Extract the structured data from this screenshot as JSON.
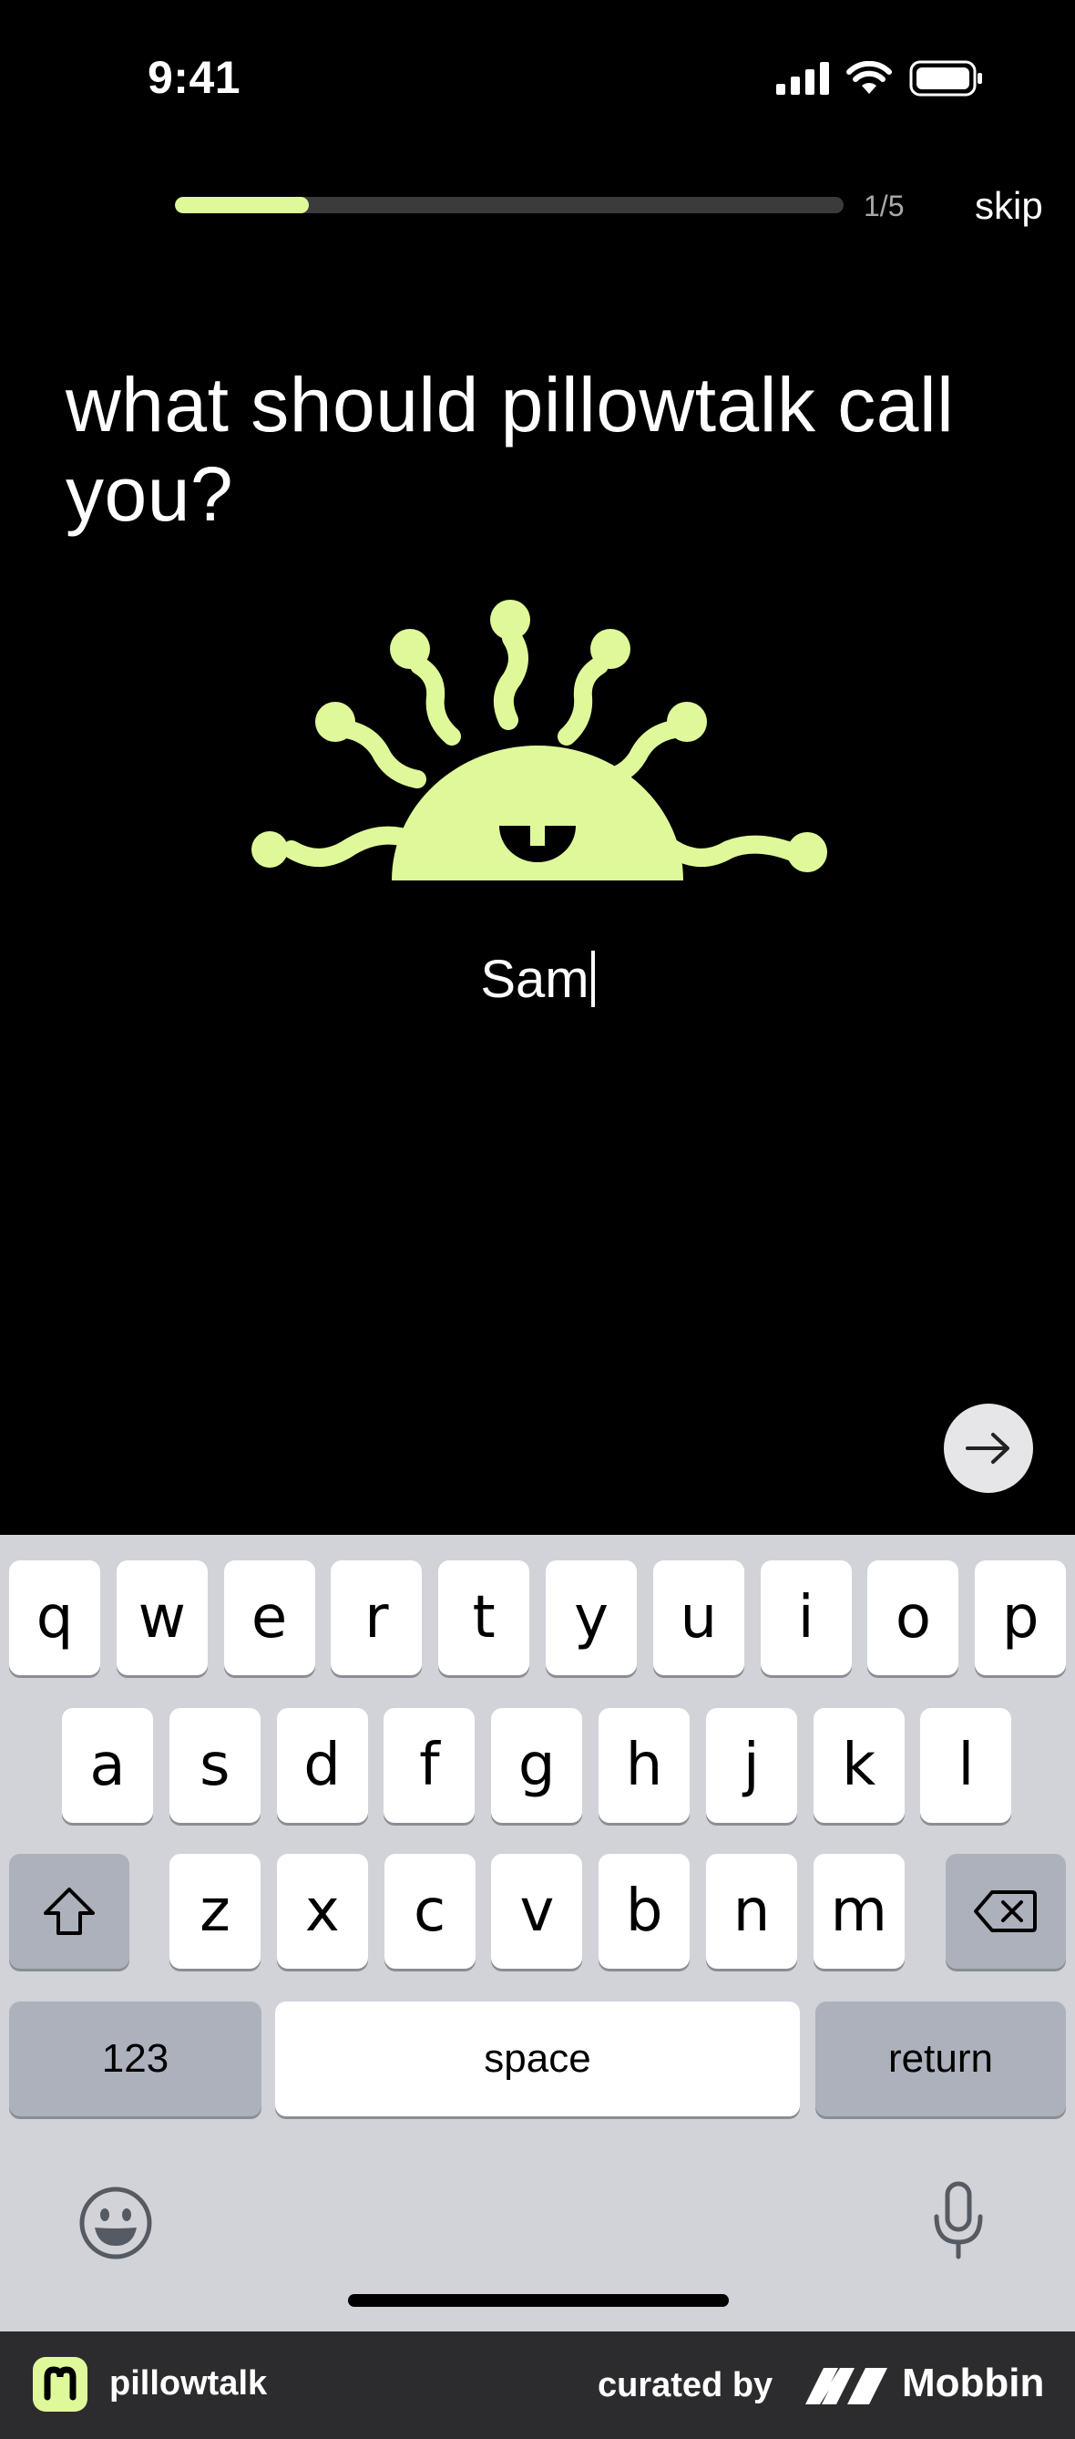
{
  "status_bar": {
    "time": "9:41"
  },
  "progress": {
    "label": "1/5",
    "fraction": 0.2
  },
  "skip_label": "skip",
  "question": "what should pillowtalk call you?",
  "name_input": {
    "value": "Sam"
  },
  "colors": {
    "accent": "#dff99a",
    "background": "#000000",
    "keyboard_bg": "#d1d3d9"
  },
  "keyboard": {
    "row1": [
      "q",
      "w",
      "e",
      "r",
      "t",
      "y",
      "u",
      "i",
      "o",
      "p"
    ],
    "row2": [
      "a",
      "s",
      "d",
      "f",
      "g",
      "h",
      "j",
      "k",
      "l"
    ],
    "row3": [
      "z",
      "x",
      "c",
      "v",
      "b",
      "n",
      "m"
    ],
    "numbers_label": "123",
    "space_label": "space",
    "return_label": "return"
  },
  "footer": {
    "app_name": "pillowtalk",
    "curated_label": "curated by",
    "brand": "Mobbin"
  }
}
